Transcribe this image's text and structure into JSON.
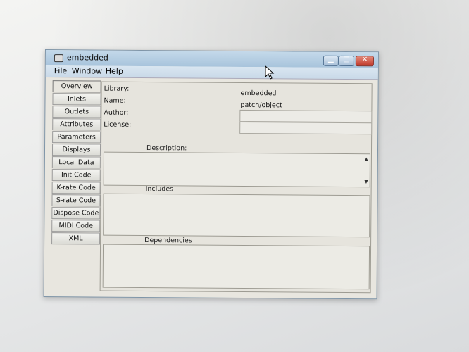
{
  "window": {
    "title": "embedded",
    "icon": "app-icon",
    "controls": [
      "minimize-icon",
      "maximize-icon",
      "close-icon"
    ]
  },
  "menu": [
    "File",
    "Window",
    "Help"
  ],
  "tabs": [
    "Overview",
    "Inlets",
    "Outlets",
    "Attributes",
    "Parameters",
    "Displays",
    "Local Data",
    "Init Code",
    "K-rate Code",
    "S-rate Code",
    "Dispose Code",
    "MIDI Code",
    "XML"
  ],
  "active_tab": "Overview",
  "overview": {
    "library_label": "Library:",
    "library_value": "embedded",
    "name_label": "Name:",
    "name_value": "patch/object",
    "author_label": "Author:",
    "author_value": "",
    "license_label": "License:",
    "license_value": "",
    "description_label": "Description:",
    "includes_label": "Includes",
    "dependencies_label": "Dependencies"
  }
}
